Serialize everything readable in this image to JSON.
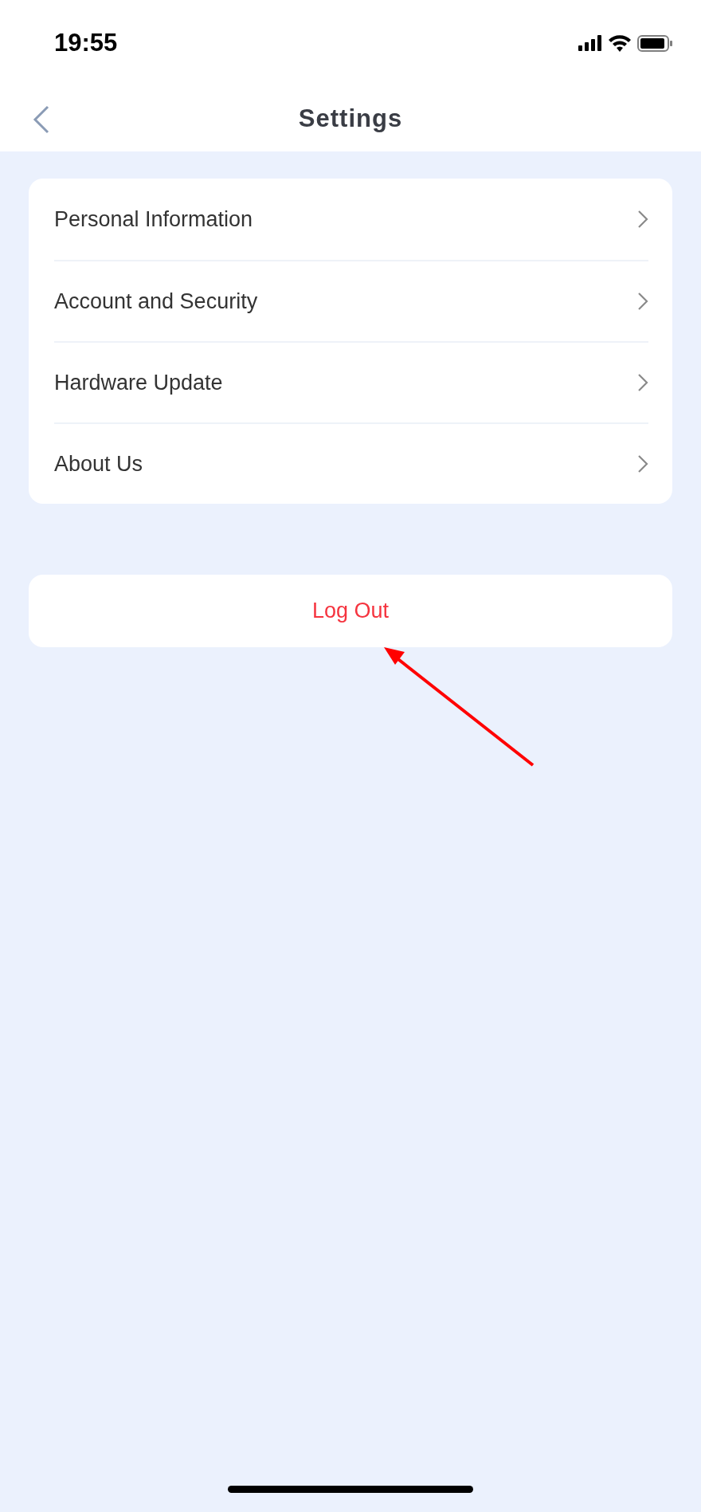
{
  "status_bar": {
    "time": "19:55"
  },
  "header": {
    "title": "Settings"
  },
  "menu_items": [
    {
      "label": "Personal Information"
    },
    {
      "label": "Account and Security"
    },
    {
      "label": "Hardware Update"
    },
    {
      "label": "About Us"
    }
  ],
  "logout_button": {
    "label": "Log Out"
  }
}
